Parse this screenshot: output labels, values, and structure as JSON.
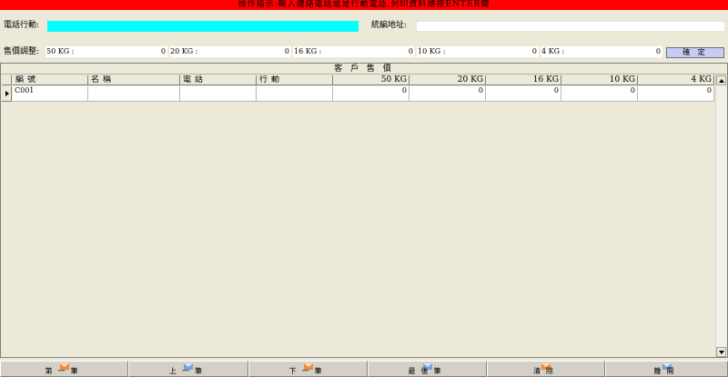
{
  "banner": {
    "text": "操作指示:輸入連絡電話或是行動電話,列印資料請按ENTER鍵",
    "color": "#ff0000"
  },
  "search": {
    "phone_label": "電話行動:",
    "phone_value": "",
    "taxid_label": "統編地址:",
    "taxid_value": ""
  },
  "price_adjust": {
    "label": "售價調整:",
    "fields": [
      {
        "label": "50 KG :",
        "value": "0"
      },
      {
        "label": "20 KG :",
        "value": "0"
      },
      {
        "label": "16 KG :",
        "value": "0"
      },
      {
        "label": "10 KG :",
        "value": "0"
      },
      {
        "label": "4 KG :",
        "value": "0"
      }
    ],
    "confirm_label": "確 定"
  },
  "grid": {
    "title": "客 戶 售 價",
    "columns": [
      "編號",
      "名稱",
      "電話",
      "行動",
      "50 KG",
      "20 KG",
      "16 KG",
      "10 KG",
      "4 KG"
    ],
    "rows": [
      {
        "id": "C001",
        "name": "",
        "phone": "",
        "mobile": "",
        "kg50": "0",
        "kg20": "0",
        "kg16": "0",
        "kg10": "0",
        "kg4": "0"
      }
    ]
  },
  "footer": {
    "buttons": [
      {
        "label": "第一筆",
        "icon": "orange-envelope-icon"
      },
      {
        "label": "上一筆",
        "icon": "blue-envelope-icon"
      },
      {
        "label": "下一筆",
        "icon": "orange-envelope-icon"
      },
      {
        "label": "最後筆",
        "icon": "blue-envelope-icon"
      },
      {
        "label": "清除",
        "icon": "orange-envelope-icon"
      },
      {
        "label": "離開",
        "icon": "blue-envelope-icon"
      }
    ]
  }
}
